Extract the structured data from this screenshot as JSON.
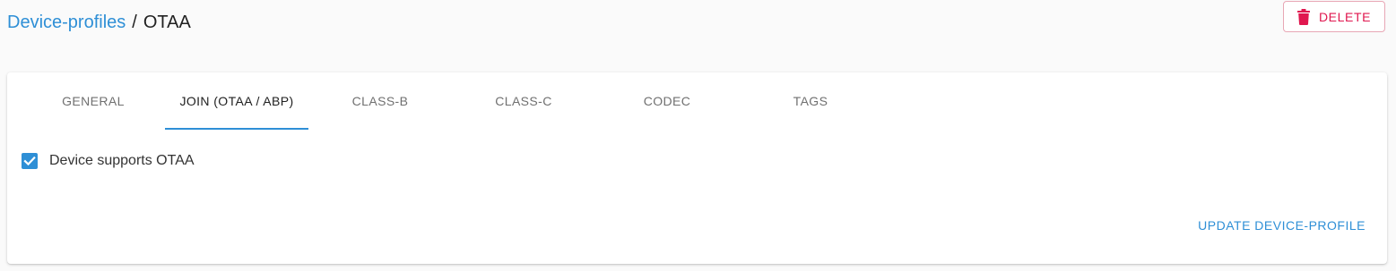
{
  "breadcrumb": {
    "parent": "Device-profiles",
    "separator": "/",
    "current": "OTAA"
  },
  "header": {
    "delete_label": "DELETE",
    "delete_icon": "trash-icon"
  },
  "tabs": [
    {
      "label": "GENERAL",
      "active": false
    },
    {
      "label": "JOIN (OTAA / ABP)",
      "active": true
    },
    {
      "label": "CLASS-B",
      "active": false
    },
    {
      "label": "CLASS-C",
      "active": false
    },
    {
      "label": "CODEC",
      "active": false
    },
    {
      "label": "TAGS",
      "active": false
    }
  ],
  "form": {
    "supports_otaa_label": "Device supports OTAA",
    "supports_otaa_checked": true
  },
  "actions": {
    "update_label": "UPDATE DEVICE-PROFILE"
  },
  "colors": {
    "accent": "#2e8fd6",
    "danger": "#e0174f"
  }
}
